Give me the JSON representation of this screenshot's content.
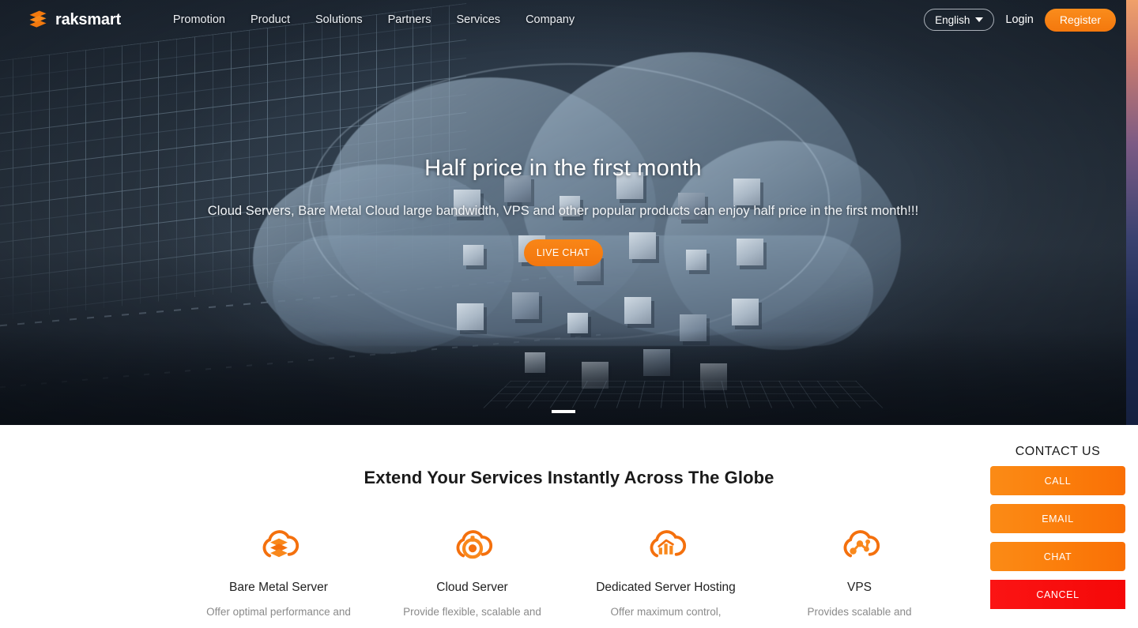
{
  "header": {
    "logo": {
      "icon": "raksmart-logo-icon",
      "text": "raksmart"
    },
    "nav": [
      {
        "label": "Promotion"
      },
      {
        "label": "Product"
      },
      {
        "label": "Solutions"
      },
      {
        "label": "Partners"
      },
      {
        "label": "Services"
      },
      {
        "label": "Company"
      }
    ],
    "language": {
      "value": "English",
      "caret_icon": "chevron-down-icon"
    },
    "login_label": "Login",
    "register_label": "Register"
  },
  "hero": {
    "title": "Half price in the first month",
    "subtitle": "Cloud Servers, Bare Metal Cloud large bandwidth, VPS and other popular products can enjoy half price in the first month!!!",
    "cta_label": "LIVE CHAT",
    "slides_total": 1,
    "active_slide": 1
  },
  "main": {
    "section_title": "Extend Your Services Instantly Across The Globe",
    "features": [
      {
        "icon": "cloud-server-stack-icon",
        "title": "Bare Metal Server",
        "desc": "Offer optimal performance and"
      },
      {
        "icon": "cloud-gear-icon",
        "title": "Cloud Server",
        "desc": "Provide flexible, scalable and"
      },
      {
        "icon": "cloud-chart-icon",
        "title": "Dedicated Server Hosting",
        "desc": "Offer maximum control,"
      },
      {
        "icon": "cloud-network-icon",
        "title": "VPS",
        "desc": "Provides scalable and"
      }
    ]
  },
  "contact_panel": {
    "heading": "CONTACT US",
    "buttons": [
      {
        "label": "CALL"
      },
      {
        "label": "EMAIL"
      },
      {
        "label": "CHAT"
      },
      {
        "label": "CANCEL"
      }
    ]
  },
  "colors": {
    "brand_orange": "#f97d0c",
    "cancel_red": "#fa0e0e",
    "hero_dark": "#232d39",
    "text_dark": "#1a1a1a",
    "text_muted": "#8a8a8a"
  }
}
